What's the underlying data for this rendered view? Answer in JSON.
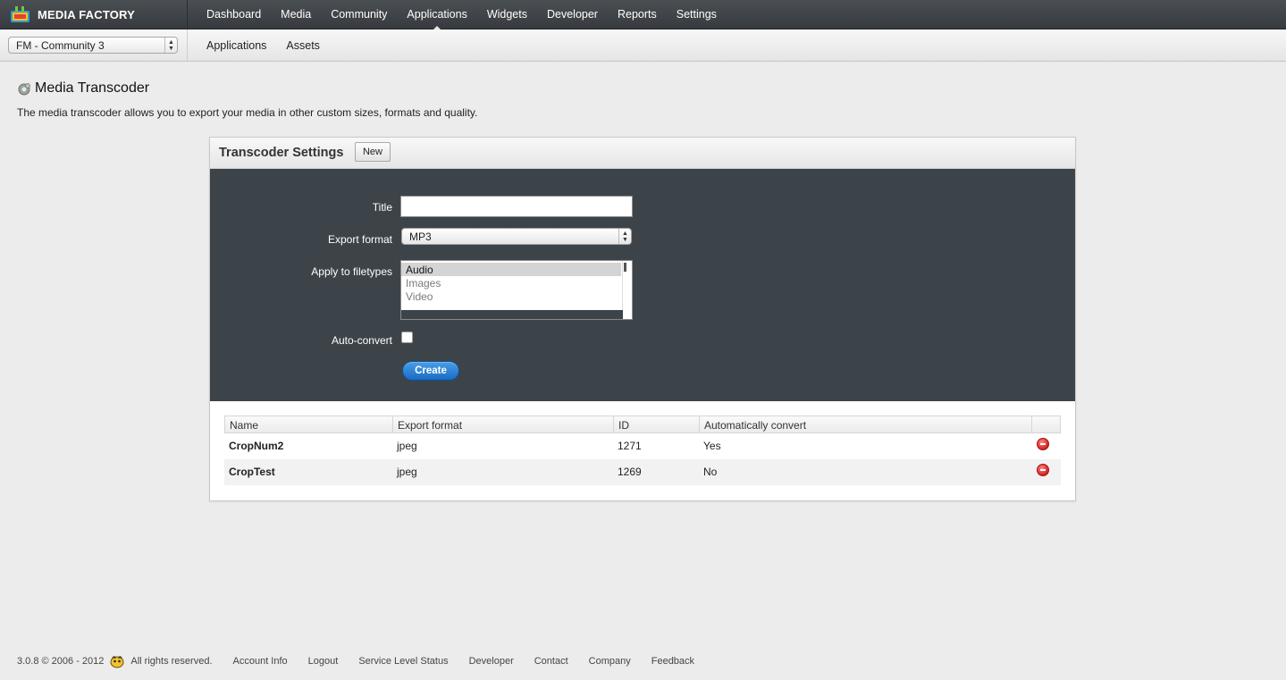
{
  "brand": {
    "name": "MEDIA FACTORY",
    "logo_icon": "media-factory-logo-icon"
  },
  "nav": {
    "items": [
      {
        "label": "Dashboard"
      },
      {
        "label": "Media"
      },
      {
        "label": "Community"
      },
      {
        "label": "Applications",
        "active": true
      },
      {
        "label": "Widgets"
      },
      {
        "label": "Developer"
      },
      {
        "label": "Reports"
      },
      {
        "label": "Settings"
      }
    ]
  },
  "community_select": {
    "value": "FM - Community 3"
  },
  "subnav": {
    "items": [
      {
        "label": "Applications"
      },
      {
        "label": "Assets"
      }
    ]
  },
  "page": {
    "title": "Media Transcoder",
    "description": "The media transcoder allows you to export your media in other custom sizes, formats and quality."
  },
  "panel": {
    "title": "Transcoder Settings",
    "new_label": "New",
    "form": {
      "title_label": "Title",
      "title_value": "",
      "format_label": "Export format",
      "format_value": "MP3",
      "filetypes_label": "Apply to filetypes",
      "filetypes": [
        "Audio",
        "Images",
        "Video"
      ],
      "filetypes_selected": "Audio",
      "autoconvert_label": "Auto-convert",
      "autoconvert_checked": false,
      "create_label": "Create"
    },
    "table": {
      "headers": [
        "Name",
        "Export format",
        "ID",
        "Automatically convert",
        ""
      ],
      "rows": [
        {
          "name": "CropNum2",
          "format": "jpeg",
          "id": "1271",
          "auto": "Yes"
        },
        {
          "name": "CropTest",
          "format": "jpeg",
          "id": "1269",
          "auto": "No"
        }
      ]
    }
  },
  "footer": {
    "copyright": "3.0.8 © 2006 - 2012",
    "rights": "All rights reserved.",
    "links": [
      "Account Info",
      "Logout",
      "Service Level Status",
      "Developer",
      "Contact",
      "Company",
      "Feedback"
    ]
  },
  "colors": {
    "topbar": "#3f4448",
    "form_bg": "#3d4449",
    "create_button": "#1f72c9",
    "delete_icon": "#d4201e"
  }
}
